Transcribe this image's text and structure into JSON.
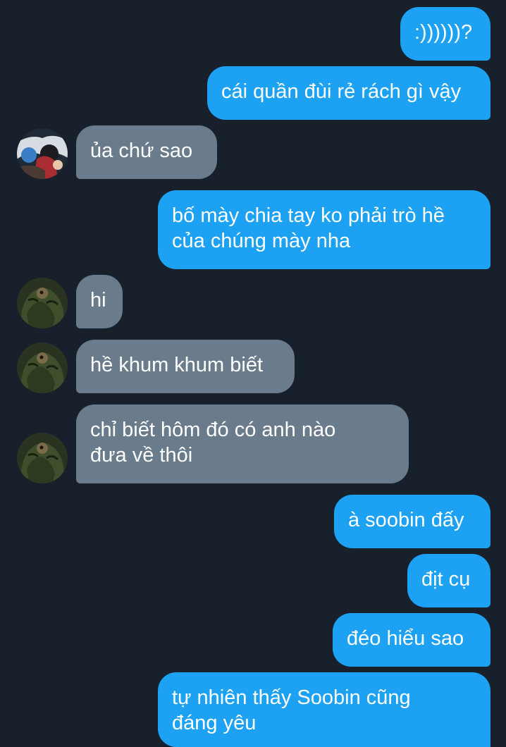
{
  "conversation": {
    "messages": [
      {
        "direction": "outgoing",
        "text": ":))))))?"
      },
      {
        "direction": "outgoing",
        "text": "cái quần đùi rẻ rách gì vậy"
      },
      {
        "direction": "incoming",
        "text": "ủa chứ sao",
        "avatar_icon": "illustrated-profile-avatar"
      },
      {
        "direction": "outgoing",
        "text": "bố mày chia tay ko phải trò hề\ncủa chúng mày nha"
      },
      {
        "direction": "incoming",
        "text": "hi",
        "avatar_icon": "green-profile-avatar"
      },
      {
        "direction": "incoming",
        "text": "hề khum khum biết",
        "avatar_icon": "green-profile-avatar"
      },
      {
        "direction": "incoming",
        "text": "chỉ biết hôm đó có anh nào\nđưa về thôi",
        "avatar_icon": "green-profile-avatar"
      },
      {
        "direction": "outgoing",
        "text": "à soobin đấy"
      },
      {
        "direction": "outgoing",
        "text": "địt cụ"
      },
      {
        "direction": "outgoing",
        "text": "đéo hiểu sao"
      },
      {
        "direction": "outgoing",
        "text": "tự nhiên thấy Soobin cũng\nđáng yêu"
      }
    ]
  },
  "colors": {
    "background": "#17202b",
    "outgoing_bubble": "#1da1f2",
    "incoming_bubble": "#6a7b8b",
    "text": "#ffffff"
  }
}
